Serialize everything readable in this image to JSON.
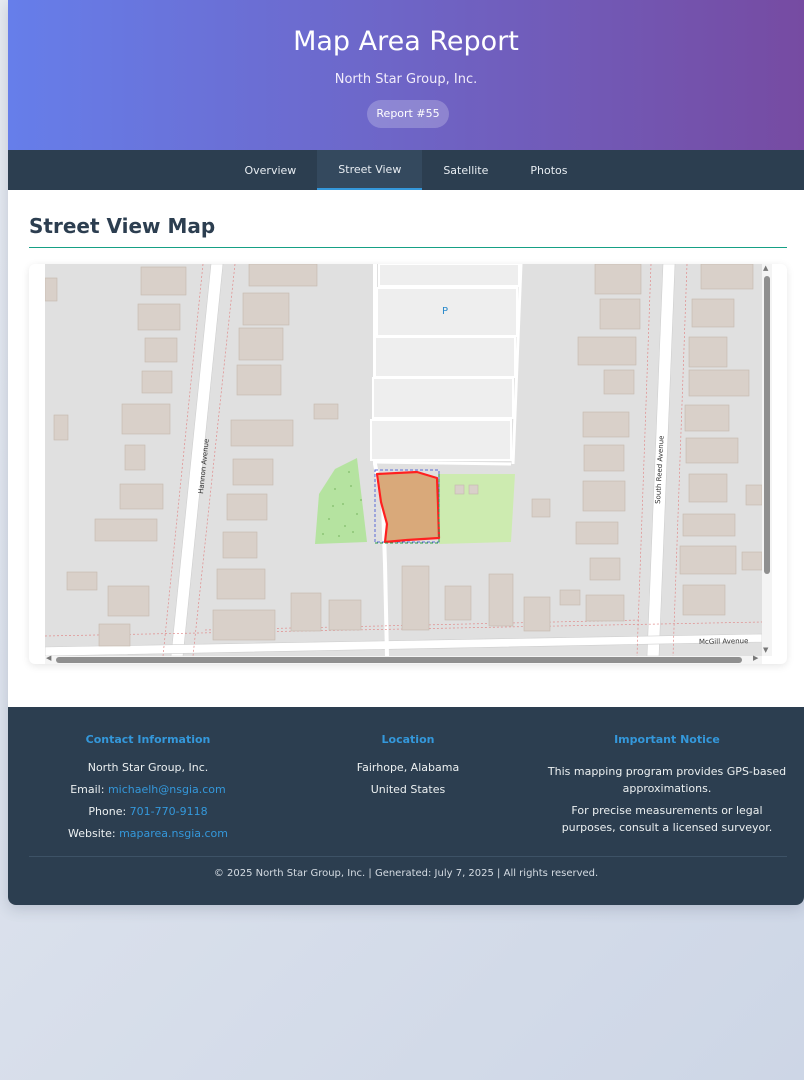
{
  "header": {
    "title": "Map Area Report",
    "company": "North Star Group, Inc.",
    "badge": "Report #55"
  },
  "nav": {
    "tabs": [
      "Overview",
      "Street View",
      "Satellite",
      "Photos"
    ],
    "active": "Street View"
  },
  "section": {
    "title": "Street View Map"
  },
  "map": {
    "street_labels": [
      "Hannon Avenue",
      "South Reed Avenue",
      "McGill Avenue"
    ],
    "parking_label": "P",
    "colors": {
      "background": "#e0e0e0",
      "building": "#d9d0c9",
      "building_stroke": "#c4b8ad",
      "road": "#ffffff",
      "parking": "#eeeeee",
      "grass": "#cdebb0",
      "park": "#b5e3a0",
      "parcel_fill": "#d9a97a",
      "parcel_outline": "#ff2020",
      "selection_box": "#5a6ad6"
    }
  },
  "footer": {
    "contact": {
      "heading": "Contact Information",
      "company": "North Star Group, Inc.",
      "email_label": "Email:",
      "email": "michaelh@nsgia.com",
      "phone_label": "Phone:",
      "phone": "701-770-9118",
      "website_label": "Website:",
      "website": "maparea.nsgia.com"
    },
    "location": {
      "heading": "Location",
      "city": "Fairhope, Alabama",
      "country": "United States"
    },
    "notice": {
      "heading": "Important Notice",
      "line1": "This mapping program provides GPS-based approximations.",
      "line2": "For precise measurements or legal purposes, consult a licensed surveyor."
    },
    "copyright": "© 2025 North Star Group, Inc. | Generated: July 7, 2025 | All rights reserved."
  }
}
